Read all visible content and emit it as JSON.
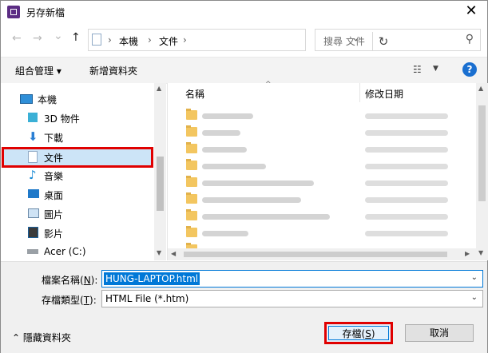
{
  "window": {
    "title": "另存新檔",
    "close_glyph": "✕"
  },
  "nav": {
    "back_glyph": "←",
    "forward_glyph": "→",
    "recent_glyph": "⌄",
    "up_glyph": "↑",
    "breadcrumb": [
      "本機",
      "文件"
    ],
    "sep_glyph": "›",
    "refresh_glyph": "↻",
    "search_placeholder": "搜尋 文件"
  },
  "toolbar": {
    "organize_label": "組合管理 ▾",
    "new_folder_label": "新增資料夾",
    "view_glyph": "☷",
    "help_glyph": "?"
  },
  "sidebar": {
    "items": [
      {
        "label": "本機",
        "icon": "computer-icon"
      },
      {
        "label": "3D 物件",
        "icon": "cube-icon"
      },
      {
        "label": "下載",
        "icon": "download-icon"
      },
      {
        "label": "文件",
        "icon": "document-icon",
        "selected": true
      },
      {
        "label": "音樂",
        "icon": "music-icon"
      },
      {
        "label": "桌面",
        "icon": "desktop-icon"
      },
      {
        "label": "圖片",
        "icon": "picture-icon"
      },
      {
        "label": "影片",
        "icon": "video-icon"
      },
      {
        "label": "Acer (C:)",
        "icon": "drive-icon"
      }
    ]
  },
  "filelist": {
    "col_name": "名稱",
    "col_date": "修改日期",
    "sort_glyph": "^",
    "rows": 9
  },
  "form": {
    "filename_label": "檔案名稱(",
    "filename_key": "N",
    "filename_label_end": "):",
    "filename_value": "HUNG-LAPTOP.html",
    "type_label": "存檔類型(",
    "type_key": "T",
    "type_label_end": "):",
    "type_value": "HTML File (*.htm)",
    "dd_glyph": "⌄"
  },
  "footer": {
    "hide_folders_label": "⌃  隱藏資料夾",
    "save_label": "存檔(",
    "save_key": "S",
    "save_label_end": ")",
    "cancel_label": "取消"
  }
}
